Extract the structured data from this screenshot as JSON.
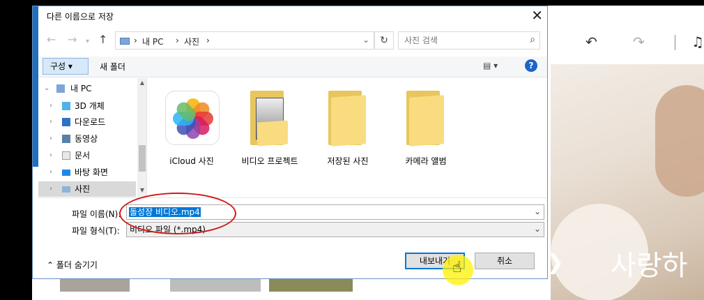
{
  "dialog": {
    "title": "다른 이름으로 저장",
    "close_icon": "close-icon"
  },
  "nav": {
    "back_icon": "arrow-left-icon",
    "forward_icon": "arrow-right-icon",
    "recent_icon": "chevron-down-icon",
    "up_icon": "arrow-up-icon",
    "breadcrumb": [
      "내 PC",
      "사진"
    ],
    "refresh_icon": "refresh-icon",
    "search_placeholder": "사진 검색"
  },
  "commandbar": {
    "organize_label": "구성 ▾",
    "new_folder_label": "새 폴더",
    "view_icon": "view-options-icon",
    "help_label": "?"
  },
  "tree": {
    "items": [
      {
        "label": "내 PC",
        "icon": "computer-icon",
        "expanded": true
      },
      {
        "label": "3D 개체",
        "icon": "3d-objects-icon"
      },
      {
        "label": "다운로드",
        "icon": "download-icon"
      },
      {
        "label": "동영상",
        "icon": "video-icon"
      },
      {
        "label": "문서",
        "icon": "document-icon"
      },
      {
        "label": "바탕 화면",
        "icon": "desktop-icon"
      },
      {
        "label": "사진",
        "icon": "pictures-icon",
        "selected": true
      }
    ]
  },
  "files": [
    {
      "label": "iCloud 사진",
      "icon": "photos-app-icon"
    },
    {
      "label": "비디오 프로젝트",
      "icon": "folder-with-photo-icon"
    },
    {
      "label": "저장된 사진",
      "icon": "folder-icon"
    },
    {
      "label": "카메라 앨범",
      "icon": "folder-icon"
    }
  ],
  "form": {
    "filename_label": "파일 이름(N):",
    "filename_value": "돌성장 비디오.mp4",
    "filetype_label": "파일 형식(T):",
    "filetype_value": "비디오 파일 (*.mp4)"
  },
  "footer": {
    "hide_folders_label": "폴더 숨기기",
    "export_label": "내보내기",
    "cancel_label": "취소"
  },
  "background": {
    "caption": "사랑하",
    "colors": {
      "accent": "#1f6fbf",
      "highlight": "#0078d7",
      "annotation": "#d01818"
    }
  }
}
